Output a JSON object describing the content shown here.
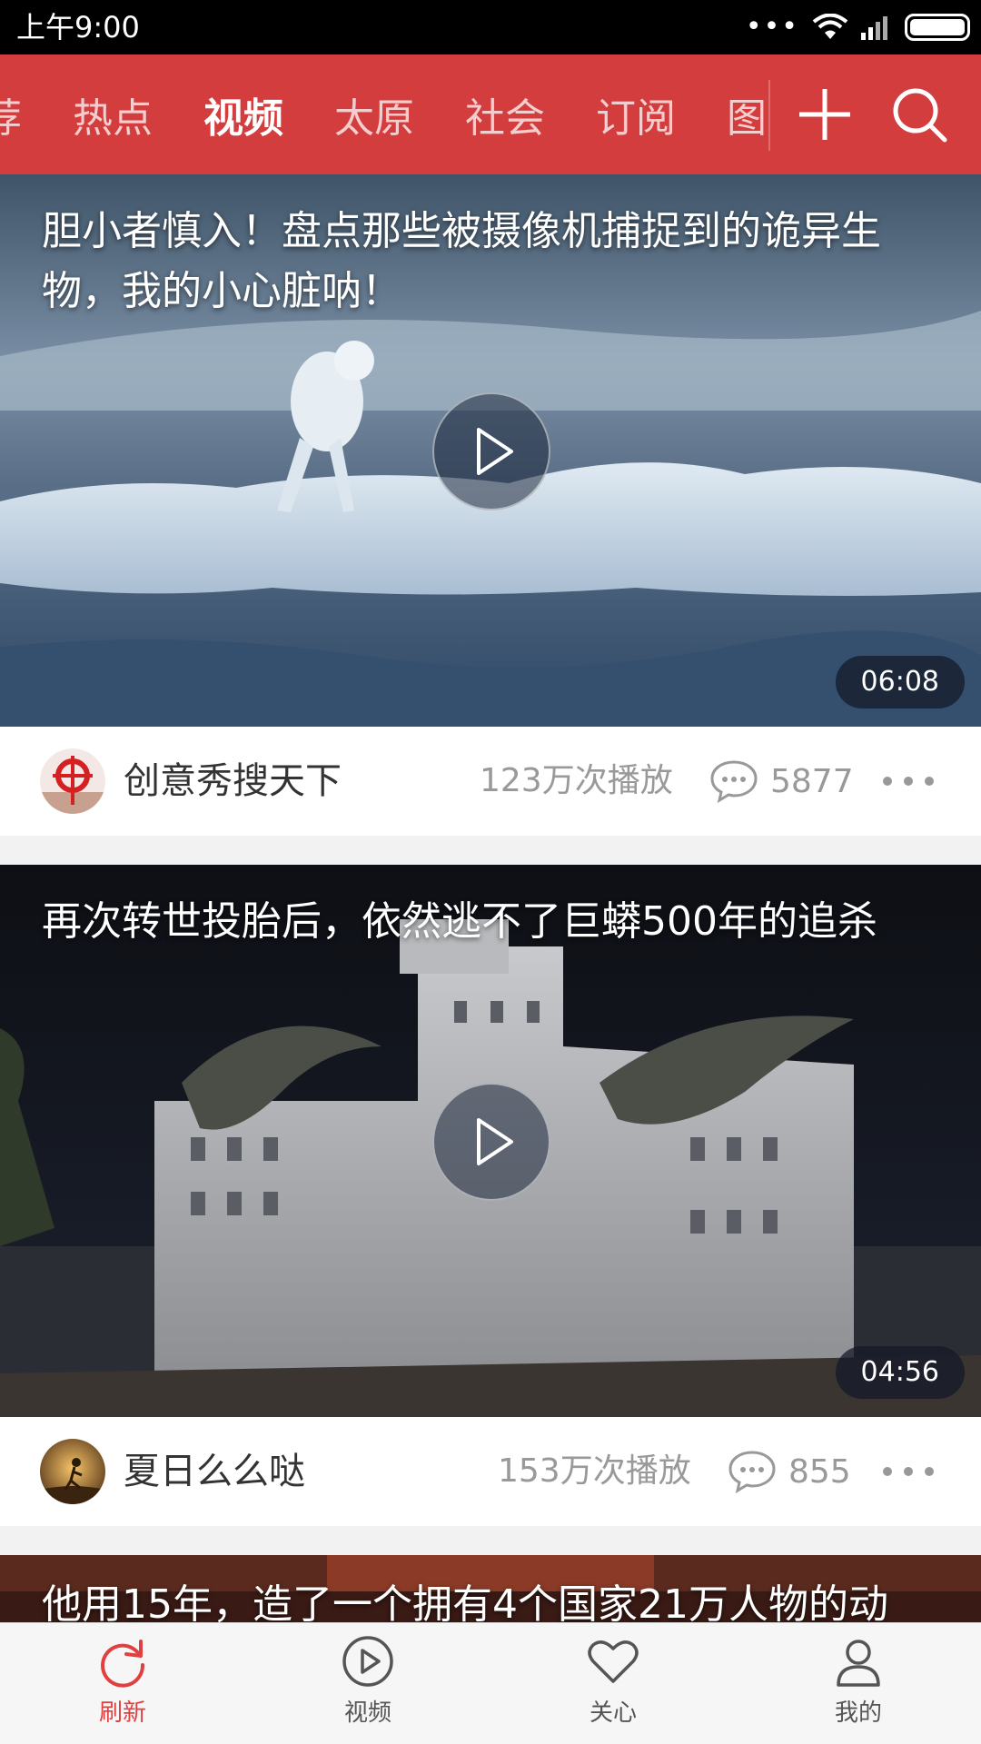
{
  "status_bar": {
    "time": "上午9:00",
    "dots": "•••"
  },
  "channels": {
    "tabs": [
      "荐",
      "热点",
      "视频",
      "太原",
      "社会",
      "订阅",
      "图"
    ],
    "active_index": 2,
    "icons": {
      "add": "plus-icon",
      "search": "search-icon"
    }
  },
  "feed": [
    {
      "title": "胆小者慎入！盘点那些被摄像机捕捉到的诡异生物，我的小心脏呐！",
      "duration": "06:08",
      "author": "创意秀搜天下",
      "plays": "123万次播放",
      "comments": "5877"
    },
    {
      "title": "再次转世投胎后，依然逃不了巨蟒500年的追杀",
      "duration": "04:56",
      "author": "夏日么么哒",
      "plays": "153万次播放",
      "comments": "855"
    },
    {
      "title": "他用15年，造了一个拥有4个国家21万人物的动"
    }
  ],
  "bottom_nav": [
    {
      "label": "刷新",
      "icon": "refresh-icon",
      "active": true
    },
    {
      "label": "视频",
      "icon": "video-play-icon",
      "active": false
    },
    {
      "label": "关心",
      "icon": "heart-icon",
      "active": false
    },
    {
      "label": "我的",
      "icon": "user-icon",
      "active": false
    }
  ],
  "colors": {
    "brand_red": "#d43d3d",
    "active_nav": "#e04040"
  }
}
